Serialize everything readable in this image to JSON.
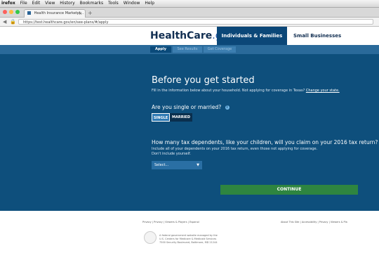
{
  "menubar": {
    "app": "irefox",
    "items": [
      "File",
      "Edit",
      "View",
      "History",
      "Bookmarks",
      "Tools",
      "Window",
      "Help"
    ]
  },
  "browser": {
    "tab_title": "Health Insurance Marketpl...",
    "new_tab": "+",
    "url": "https://test.healthcare.gov/en/see-plans/#/apply"
  },
  "header": {
    "logo_health": "HealthCare",
    "logo_gov": ".gov",
    "nav_individuals": "Individuals & Families",
    "nav_small_businesses": "Small Businesses"
  },
  "steps": [
    "Apply",
    "See Results",
    "Get Coverage"
  ],
  "form": {
    "title": "Before you get started",
    "intro": "Fill in the information below about your household. Not applying for coverage in Texas?",
    "change_state": "Change your state.",
    "q_married": "Are you single or married?",
    "single_label": "SINGLE",
    "married_label": "MARRIED",
    "q_dependents": "How many tax dependents, like your children, will you claim on your 2016 tax return?",
    "help_line1": "Include all of your dependents on your 2016 tax return, even those not applying for coverage.",
    "help_line2": "Don't include yourself.",
    "select_placeholder": "Select...",
    "continue_label": "CONTINUE"
  },
  "footer": {
    "links_left": "Privacy  |  Privacy  |  Viewers & Players  |  Espanol",
    "links_right": "About This Site  |  Accessibility  |  Privacy  |  Viewers & Pla",
    "disclaimer": [
      "A federal government website managed by the",
      "U.S. Centers for Medicare & Medicaid Services",
      "7500 Security Boulevard, Baltimore, MD 21244"
    ]
  },
  "colors": {
    "primary_dark": "#112e51",
    "main_bg": "#0e4f7c",
    "steps_bg": "#2a6a9a",
    "continue_green": "#2e8540"
  },
  "icons": {
    "info": "info-circle-icon",
    "caret": "chevron-down-icon",
    "back": "back-arrow-icon",
    "lock": "lock-icon",
    "seal": "hhs-seal-icon"
  }
}
